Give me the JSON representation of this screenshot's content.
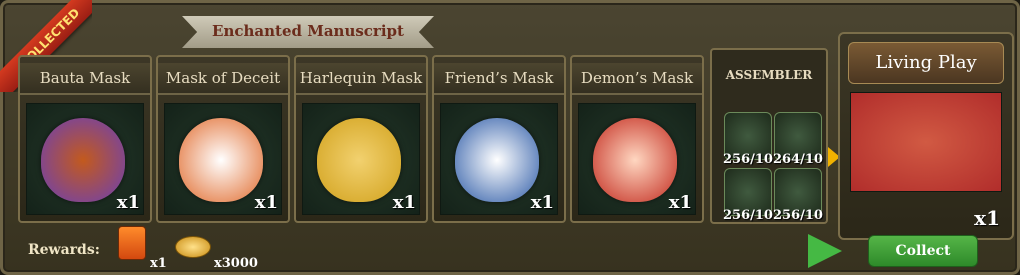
{
  "header": {
    "title": "Enchanted Manuscript",
    "badge": "COLLECTED"
  },
  "items": [
    {
      "name": "Bauta Mask",
      "qty": "x1",
      "icon": "bauta-mask-icon",
      "color": "#6a3fb6"
    },
    {
      "name": "Mask of Deceit",
      "qty": "x1",
      "icon": "deceit-mask-icon",
      "color": "#e06a2c"
    },
    {
      "name": "Harlequin Mask",
      "qty": "x1",
      "icon": "harlequin-mask-icon",
      "color": "#d1a11c"
    },
    {
      "name": "Friend’s Mask",
      "qty": "x1",
      "icon": "friends-mask-icon",
      "color": "#2c5aa6"
    },
    {
      "name": "Demon’s Mask",
      "qty": "x1",
      "icon": "demon-mask-icon",
      "color": "#c22a1e"
    }
  ],
  "assembler": {
    "title": "ASSEMBLER",
    "cells": [
      {
        "count": "256/10",
        "icon": "rose-medallion-icon"
      },
      {
        "count": "264/10",
        "icon": "eye-amulet-icon"
      },
      {
        "count": "256/10",
        "icon": "lens-ring-icon"
      },
      {
        "count": "256/10",
        "icon": "gold-cube-icon"
      }
    ]
  },
  "result": {
    "title": "Living Play",
    "qty": "x1",
    "icon": "living-play-book-icon",
    "color": "#b12d2b"
  },
  "buttons": {
    "collect": "Collect"
  },
  "rewards": {
    "label": "Rewards:",
    "juice_qty": "x1",
    "coin_qty": "x3000"
  }
}
